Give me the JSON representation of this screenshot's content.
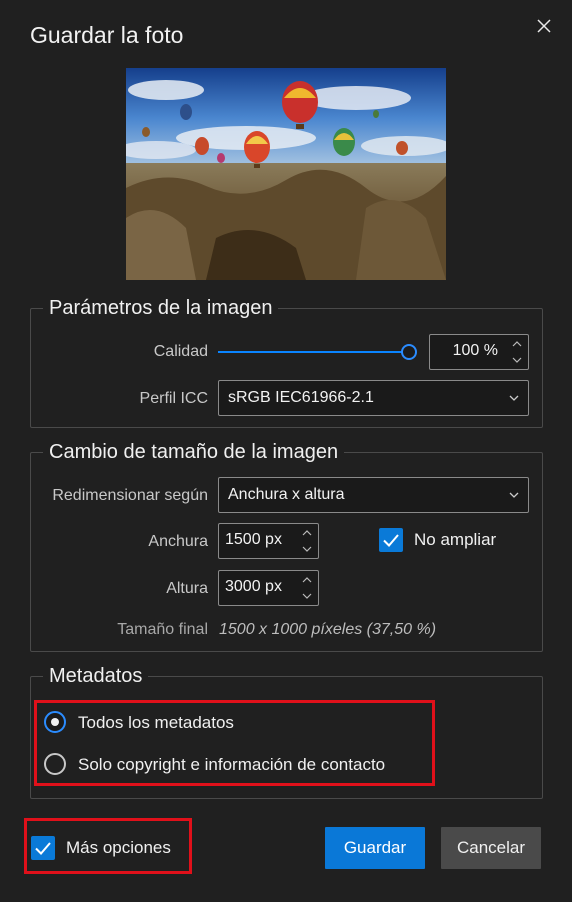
{
  "dialog": {
    "title": "Guardar la foto",
    "close_icon": "close-icon"
  },
  "preview": {
    "description_icon": "photo-preview"
  },
  "image_params": {
    "legend": "Parámetros de la imagen",
    "quality_label": "Calidad",
    "quality_value": "100 %",
    "quality_level": 1.0,
    "icc_label": "Perfil ICC",
    "icc_value": "sRGB IEC61966-2.1"
  },
  "resize": {
    "legend": "Cambio de tamaño de la imagen",
    "resize_by_label": "Redimensionar según",
    "resize_by_value": "Anchura x altura",
    "width_label": "Anchura",
    "width_value": "1500 px",
    "height_label": "Altura",
    "height_value": "3000 px",
    "no_enlarge_label": "No ampliar",
    "no_enlarge_checked": true,
    "final_size_label": "Tamaño final",
    "final_size_value": "1500 x 1000 píxeles (37,50 %)"
  },
  "metadata": {
    "legend": "Metadatos",
    "options": [
      {
        "label": "Todos los metadatos",
        "selected": true
      },
      {
        "label": "Solo copyright e información de contacto",
        "selected": false
      }
    ]
  },
  "footer": {
    "more_options_label": "Más opciones",
    "more_options_checked": true,
    "save_label": "Guardar",
    "cancel_label": "Cancelar"
  },
  "colors": {
    "accent": "#0a78d7",
    "highlight_box": "#e0101a",
    "background": "#202020"
  }
}
